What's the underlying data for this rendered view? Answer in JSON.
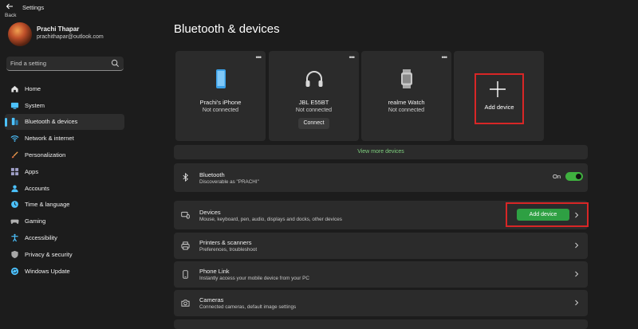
{
  "window": {
    "title": "Settings",
    "back_label": "Back"
  },
  "user": {
    "name": "Prachi Thapar",
    "email": "prachithapar@outlook.com"
  },
  "search": {
    "placeholder": "Find a setting"
  },
  "nav": {
    "items": [
      {
        "label": "Home",
        "icon": "home-icon",
        "color": "#e0e0e0"
      },
      {
        "label": "System",
        "icon": "monitor-icon",
        "color": "#4cc2ff"
      },
      {
        "label": "Bluetooth & devices",
        "icon": "bluetooth-devices-icon",
        "color": "#4cc2ff",
        "selected": true
      },
      {
        "label": "Network & internet",
        "icon": "wifi-icon",
        "color": "#4cc2ff"
      },
      {
        "label": "Personalization",
        "icon": "brush-icon",
        "color": "#f0a050"
      },
      {
        "label": "Apps",
        "icon": "apps-icon",
        "color": "#a0a0c8"
      },
      {
        "label": "Accounts",
        "icon": "person-icon",
        "color": "#4cc2ff"
      },
      {
        "label": "Time & language",
        "icon": "globe-clock-icon",
        "color": "#4cc2ff"
      },
      {
        "label": "Gaming",
        "icon": "gamepad-icon",
        "color": "#a0a0a0"
      },
      {
        "label": "Accessibility",
        "icon": "accessibility-icon",
        "color": "#4cc2ff"
      },
      {
        "label": "Privacy & security",
        "icon": "shield-icon",
        "color": "#a0a0a0"
      },
      {
        "label": "Windows Update",
        "icon": "update-icon",
        "color": "#4cc2ff"
      }
    ]
  },
  "page": {
    "title": "Bluetooth & devices"
  },
  "devices": [
    {
      "name": "Prachi's iPhone",
      "status": "Not connected",
      "icon": "phone-icon"
    },
    {
      "name": "JBL E55BT",
      "status": "Not connected",
      "icon": "headphones-icon",
      "action": "Connect"
    },
    {
      "name": "realme Watch",
      "status": "Not connected",
      "icon": "watch-icon"
    }
  ],
  "add_device_card": {
    "label": "Add device",
    "icon": "plus-icon"
  },
  "view_more": "View more devices",
  "bluetooth": {
    "title": "Bluetooth",
    "subtitle": "Discoverable as \"PRACHI\"",
    "state_label": "On",
    "on": true
  },
  "devices_row": {
    "title": "Devices",
    "subtitle": "Mouse, keyboard, pen, audio, displays and docks, other devices",
    "button": "Add device"
  },
  "printers_row": {
    "title": "Printers & scanners",
    "subtitle": "Preferences, troubleshoot"
  },
  "phone_link_row": {
    "title": "Phone Link",
    "subtitle": "Instantly access your mobile device from your PC"
  },
  "cameras_row": {
    "title": "Cameras",
    "subtitle": "Connected cameras, default image settings"
  },
  "colors": {
    "accent": "#4cc2ff",
    "toggle_on": "#3fb03f",
    "button_green": "#2ea043",
    "highlight": "#d82626"
  }
}
